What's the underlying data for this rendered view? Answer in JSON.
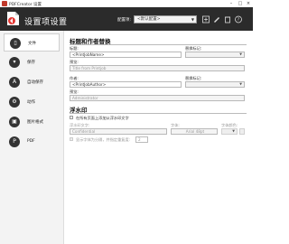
{
  "window": {
    "title": "PDFCreator 设置"
  },
  "header": {
    "title": "设置项设置",
    "profile_label": "配置项:",
    "profile_value": "<默认配置>"
  },
  "sidebar": {
    "items": [
      {
        "label": "文件",
        "icon": "document-icon"
      },
      {
        "label": "保存",
        "icon": "save-icon"
      },
      {
        "label": "自动保存",
        "icon": "autosave-icon"
      },
      {
        "label": "动作",
        "icon": "actions-icon"
      },
      {
        "label": "图片格式",
        "icon": "image-formats-icon"
      },
      {
        "label": "PDF",
        "icon": "pdf-icon"
      }
    ]
  },
  "title_author": {
    "heading": "标题和作者替换",
    "title_label": "标题:",
    "title_value": "<PrintJobName>",
    "title_token_label": "替换标记:",
    "preview_label": "预览:",
    "title_preview": "Title from Printjob",
    "author_label": "作者:",
    "author_value": "<PrintJobAuthor>",
    "author_token_label": "替换标记:",
    "author_preview_label": "预览:",
    "author_preview": "Administrator"
  },
  "watermark": {
    "heading": "浮水印",
    "enable_label": "在所有页面上添加从浮水印文字",
    "text_label": "浮水印文字:",
    "font_label": "字体:",
    "color_label": "字体颜色:",
    "text_value": "Confidential",
    "font_value": "Arial 48pt",
    "opacity_label": "显示字体为分隔，并指定重复度:",
    "opacity_value": "2"
  }
}
